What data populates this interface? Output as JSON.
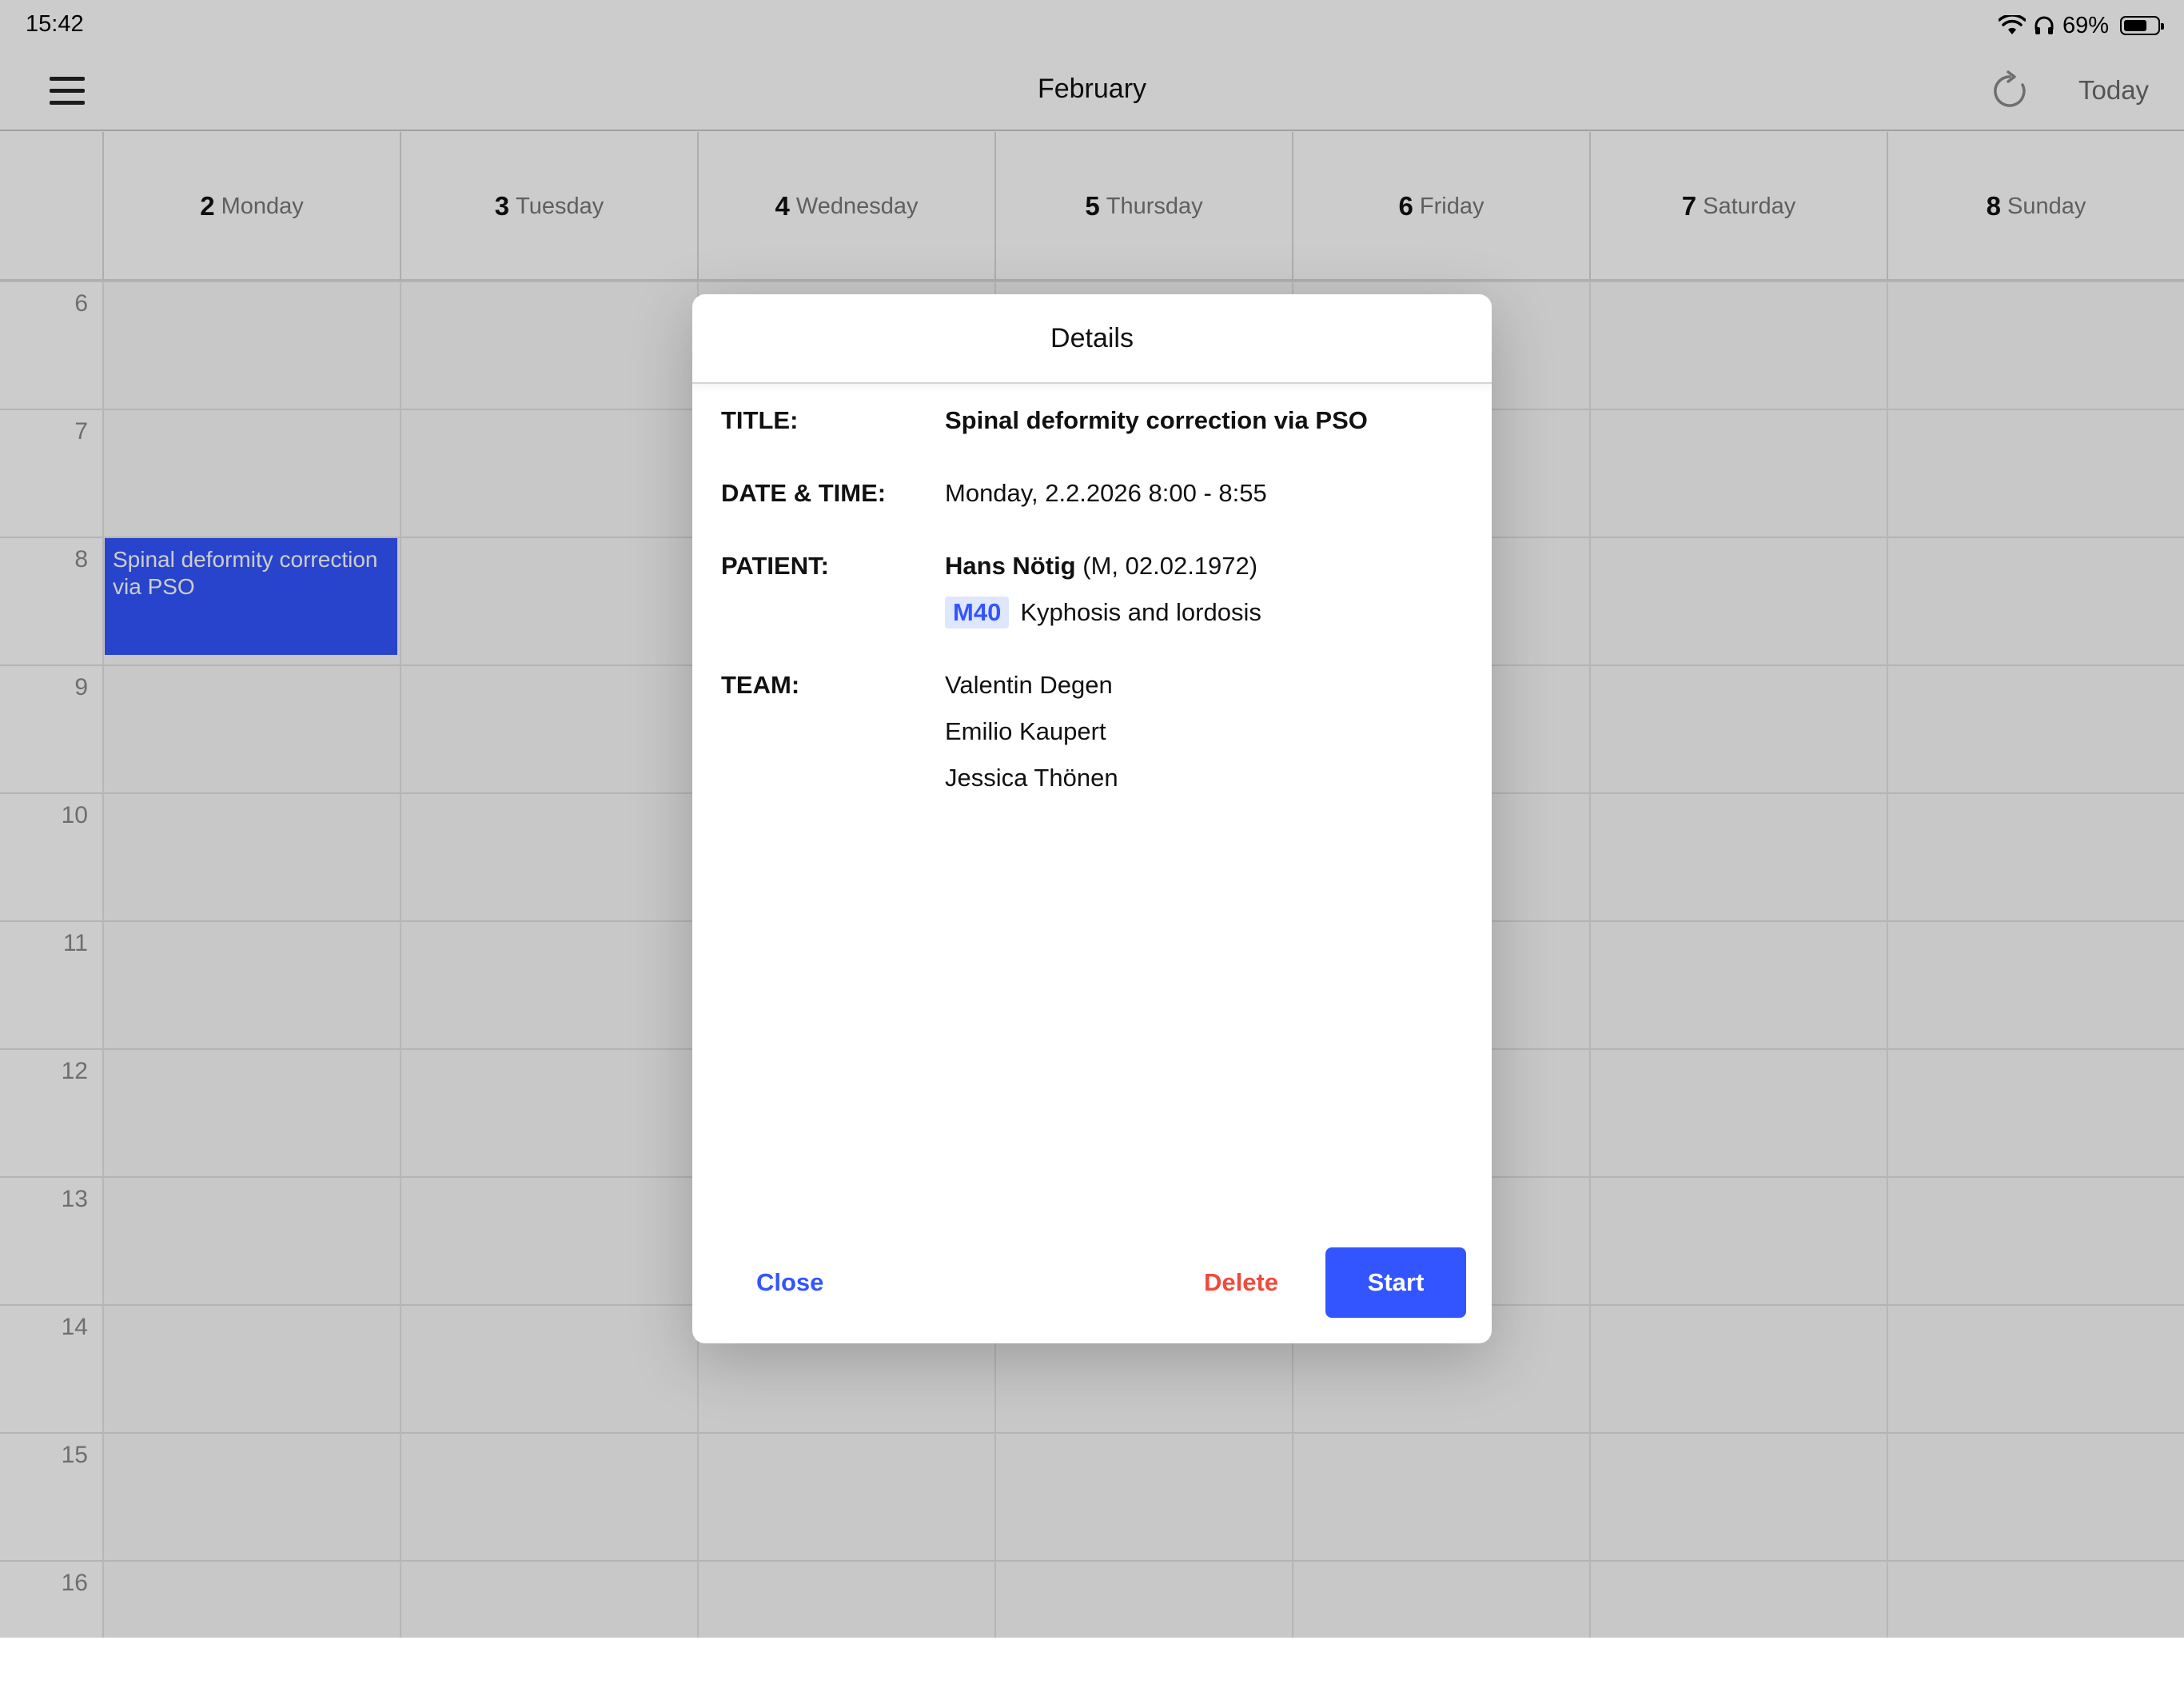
{
  "status_bar": {
    "time": "15:42",
    "battery_percent": "69%",
    "battery_level": 0.69,
    "icons": [
      "wifi-icon",
      "headphones-icon",
      "battery-icon"
    ]
  },
  "navbar": {
    "title": "February",
    "today_label": "Today",
    "icons": [
      "menu-icon",
      "refresh-icon"
    ]
  },
  "calendar": {
    "days": [
      {
        "num": "2",
        "name": "Monday"
      },
      {
        "num": "3",
        "name": "Tuesday"
      },
      {
        "num": "4",
        "name": "Wednesday"
      },
      {
        "num": "5",
        "name": "Thursday"
      },
      {
        "num": "6",
        "name": "Friday"
      },
      {
        "num": "7",
        "name": "Saturday"
      },
      {
        "num": "8",
        "name": "Sunday"
      }
    ],
    "hours": [
      "6",
      "7",
      "8",
      "9",
      "10",
      "11",
      "12",
      "13",
      "14",
      "15",
      "16"
    ],
    "events": [
      {
        "title": "Spinal deformity correction via PSO",
        "day": "Monday",
        "start": "8:00",
        "end": "8:55",
        "color": "#3355ff"
      }
    ]
  },
  "dialog": {
    "title": "Details",
    "fields": {
      "title_label": "TITLE:",
      "title_value": "Spinal deformity correction via PSO",
      "datetime_label": "DATE & TIME:",
      "datetime_value": "Monday, 2.2.2026 8:00 - 8:55",
      "patient_label": "PATIENT:",
      "patient_name": "Hans Nötig",
      "patient_info": "(M, 02.02.1972)",
      "diagnosis_code": "M40",
      "diagnosis_text": "Kyphosis and lordosis",
      "team_label": "TEAM:",
      "team": [
        "Valentin Degen",
        "Emilio Kaupert",
        "Jessica Thönen"
      ]
    },
    "buttons": {
      "close": "Close",
      "delete": "Delete",
      "start": "Start"
    }
  },
  "colors": {
    "accent": "#3355ff",
    "danger": "#f04a3c",
    "badge_bg": "#dfe7ff"
  }
}
